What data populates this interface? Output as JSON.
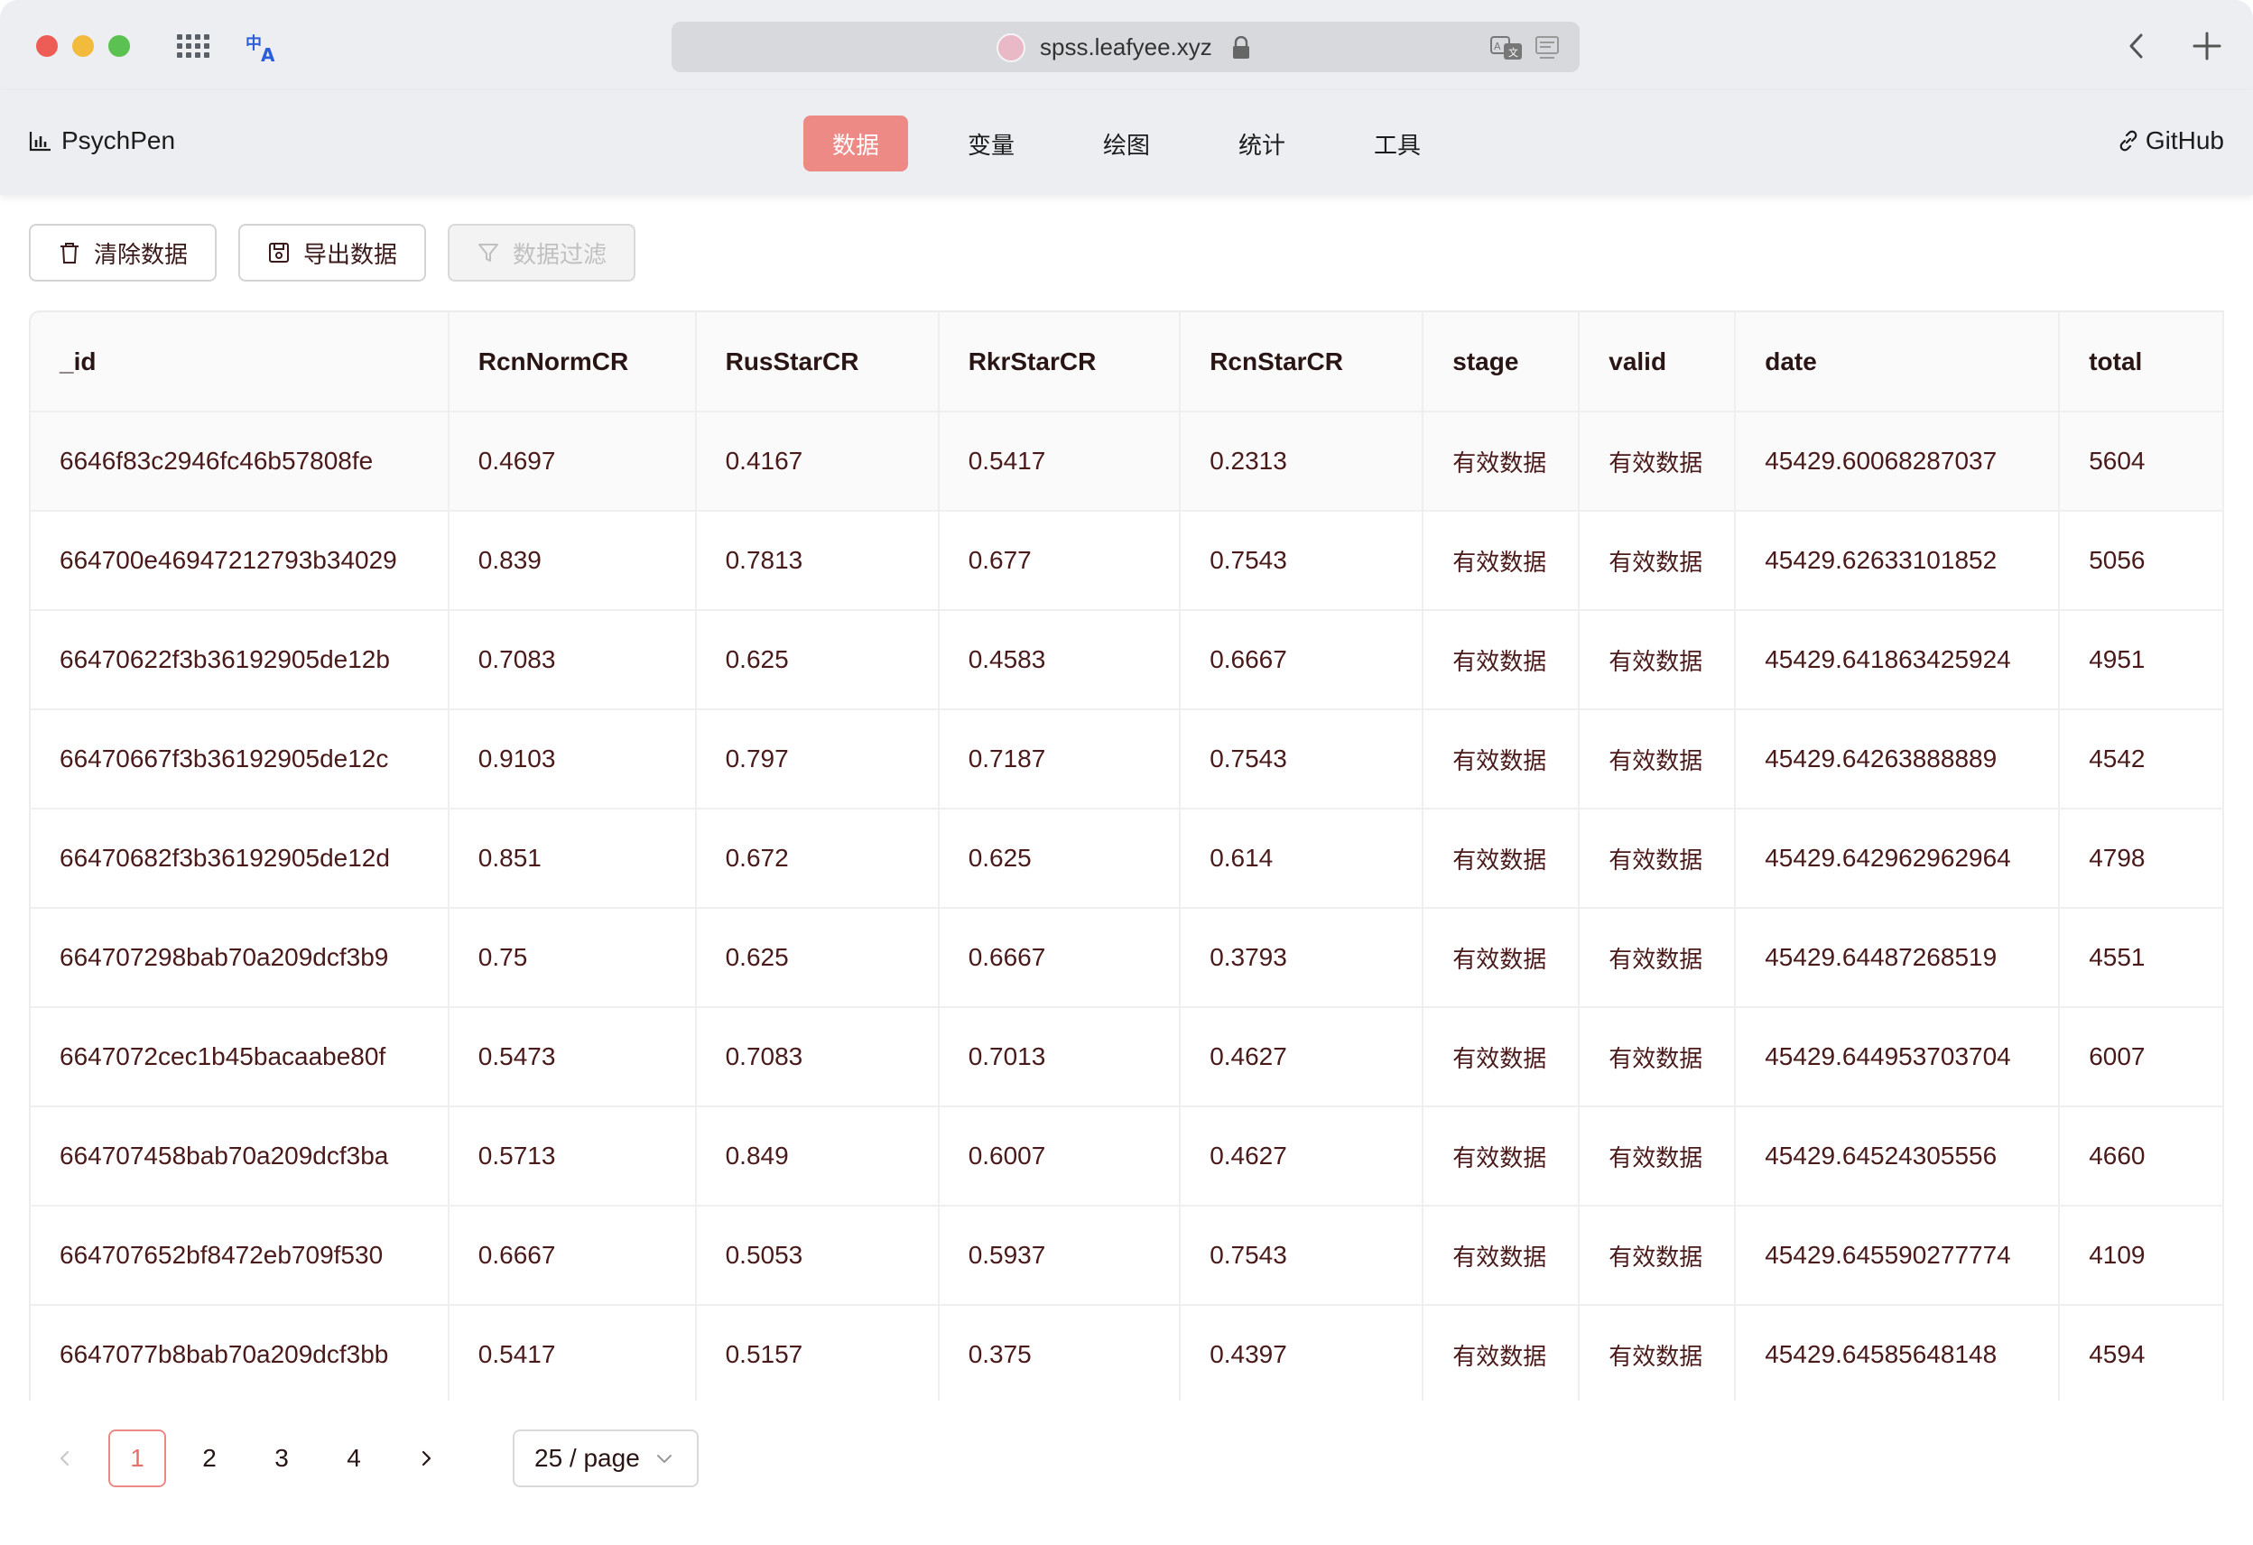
{
  "browser": {
    "url": "spss.leafyee.xyz"
  },
  "app": {
    "brand": "PsychPen",
    "nav": [
      {
        "label": "数据",
        "active": true
      },
      {
        "label": "变量",
        "active": false
      },
      {
        "label": "绘图",
        "active": false
      },
      {
        "label": "统计",
        "active": false
      },
      {
        "label": "工具",
        "active": false
      }
    ],
    "github": "GitHub",
    "accent": "#ee8a86"
  },
  "toolbar": {
    "clear": "清除数据",
    "export": "导出数据",
    "filter": "数据过滤"
  },
  "table": {
    "columns": [
      "_id",
      "RcnNormCR",
      "RusStarCR",
      "RkrStarCR",
      "RcnStarCR",
      "stage",
      "valid",
      "date",
      "total"
    ],
    "rows": [
      [
        "6646f83c2946fc46b57808fe",
        "0.4697",
        "0.4167",
        "0.5417",
        "0.2313",
        "有效数据",
        "有效数据",
        "45429.60068287037",
        "5604"
      ],
      [
        "664700e46947212793b34029",
        "0.839",
        "0.7813",
        "0.677",
        "0.7543",
        "有效数据",
        "有效数据",
        "45429.62633101852",
        "5056"
      ],
      [
        "66470622f3b36192905de12b",
        "0.7083",
        "0.625",
        "0.4583",
        "0.6667",
        "有效数据",
        "有效数据",
        "45429.641863425924",
        "4951"
      ],
      [
        "66470667f3b36192905de12c",
        "0.9103",
        "0.797",
        "0.7187",
        "0.7543",
        "有效数据",
        "有效数据",
        "45429.64263888889",
        "4542"
      ],
      [
        "66470682f3b36192905de12d",
        "0.851",
        "0.672",
        "0.625",
        "0.614",
        "有效数据",
        "有效数据",
        "45429.642962962964",
        "4798"
      ],
      [
        "664707298bab70a209dcf3b9",
        "0.75",
        "0.625",
        "0.6667",
        "0.3793",
        "有效数据",
        "有效数据",
        "45429.64487268519",
        "4551"
      ],
      [
        "6647072cec1b45bacaabe80f",
        "0.5473",
        "0.7083",
        "0.7013",
        "0.4627",
        "有效数据",
        "有效数据",
        "45429.644953703704",
        "6007"
      ],
      [
        "664707458bab70a209dcf3ba",
        "0.5713",
        "0.849",
        "0.6007",
        "0.4627",
        "有效数据",
        "有效数据",
        "45429.64524305556",
        "4660"
      ],
      [
        "664707652bf8472eb709f530",
        "0.6667",
        "0.5053",
        "0.5937",
        "0.7543",
        "有效数据",
        "有效数据",
        "45429.645590277774",
        "4109"
      ],
      [
        "6647077b8bab70a209dcf3bb",
        "0.5417",
        "0.5157",
        "0.375",
        "0.4397",
        "有效数据",
        "有效数据",
        "45429.64585648148",
        "4594"
      ]
    ]
  },
  "pagination": {
    "pages": [
      "1",
      "2",
      "3",
      "4"
    ],
    "current": "1",
    "page_size": "25 / page"
  }
}
